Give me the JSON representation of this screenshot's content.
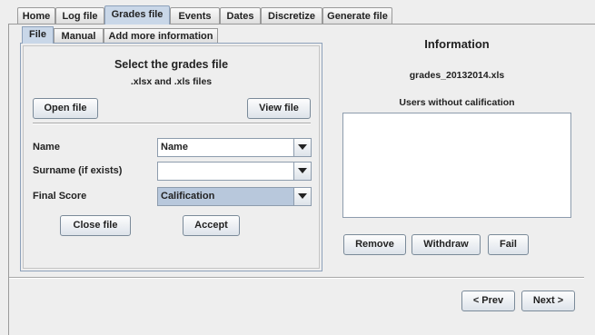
{
  "main_tabs": [
    "Home",
    "Log file",
    "Grades file",
    "Events",
    "Dates",
    "Discretize",
    "Generate file"
  ],
  "sub_tabs": [
    "File",
    "Manual",
    "Add more information"
  ],
  "file_panel": {
    "heading": "Select the grades file",
    "subheading": ".xlsx and .xls files",
    "open_label": "Open file",
    "view_label": "View file",
    "fields": [
      {
        "label": "Name",
        "value": "Name"
      },
      {
        "label": "Surname (if exists)",
        "value": ""
      },
      {
        "label": "Final Score",
        "value": "Calification"
      }
    ],
    "close_label": "Close file",
    "accept_label": "Accept"
  },
  "info": {
    "title": "Information",
    "filename": "grades_20132014.xls",
    "users_label": "Users without calification",
    "remove_label": "Remove",
    "withdraw_label": "Withdraw",
    "fail_label": "Fail"
  },
  "nav": {
    "prev_label": "< Prev",
    "next_label": "Next >"
  }
}
